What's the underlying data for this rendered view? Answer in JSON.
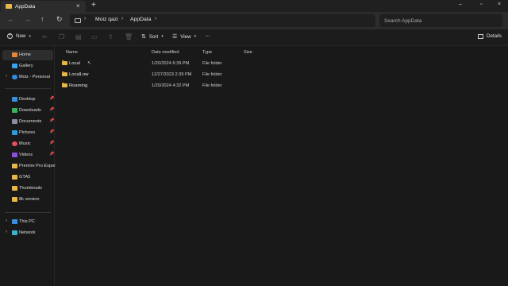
{
  "window": {
    "tab_title": "AppData",
    "new_tab_symbol": "+",
    "tab_close_symbol": "×",
    "controls": {
      "minimize": "–",
      "maximize": "▫",
      "close": "×"
    }
  },
  "nav": {
    "back": "←",
    "forward": "→",
    "up": "↑",
    "refresh": "↻"
  },
  "address": {
    "crumbs": [
      "Moiz qazi",
      "AppData"
    ],
    "sep": "›"
  },
  "search": {
    "placeholder": "Search AppData"
  },
  "toolbar": {
    "new_label": "New",
    "sort_label": "Sort",
    "view_label": "View",
    "more_label": "···",
    "details_label": "Details"
  },
  "columns": {
    "name": "Name",
    "date": "Date modified",
    "type": "Type",
    "size": "Size"
  },
  "files": [
    {
      "name": "Local",
      "date": "1/20/2024 6:39 PM",
      "type": "File folder"
    },
    {
      "name": "LocalLow",
      "date": "12/27/2023 2:39 PM",
      "type": "File folder"
    },
    {
      "name": "Roaming",
      "date": "1/20/2024 4:32 PM",
      "type": "File folder"
    }
  ],
  "sidebar": {
    "top": [
      {
        "label": "Home",
        "icon": "home-icon",
        "color": "#e8853a"
      },
      {
        "label": "Gallery",
        "icon": "gallery-icon",
        "color": "#3aa2e8"
      },
      {
        "label": "Moiz - Personal",
        "icon": "onedrive-icon",
        "color": "#2f8ae0"
      }
    ],
    "pinned": [
      {
        "label": "Desktop",
        "icon": "desktop-icon",
        "color": "#3b8de0"
      },
      {
        "label": "Downloads",
        "icon": "downloads-icon",
        "color": "#3bb35a"
      },
      {
        "label": "Documents",
        "icon": "documents-icon",
        "color": "#8a8fa0"
      },
      {
        "label": "Pictures",
        "icon": "pictures-icon",
        "color": "#2f9ad8"
      },
      {
        "label": "Music",
        "icon": "music-icon",
        "color": "#e0505e"
      },
      {
        "label": "Videos",
        "icon": "videos-icon",
        "color": "#8a4fd8"
      }
    ],
    "folders": [
      {
        "label": "Premire Pro Exports"
      },
      {
        "label": "GTA5"
      },
      {
        "label": "Thumbnails"
      },
      {
        "label": "8k version"
      }
    ],
    "bottom": [
      {
        "label": "This PC",
        "icon": "this-pc-icon",
        "color": "#3b8de0"
      },
      {
        "label": "Network",
        "icon": "network-icon",
        "color": "#3bb3c8"
      }
    ]
  },
  "colors": {
    "folder": "#e6b84a",
    "accent": "#3b8de0"
  }
}
